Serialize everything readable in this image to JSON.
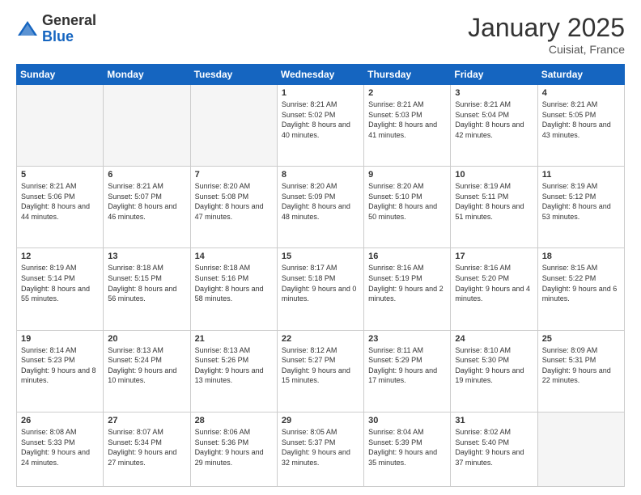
{
  "logo": {
    "general": "General",
    "blue": "Blue"
  },
  "header": {
    "month": "January 2025",
    "location": "Cuisiat, France"
  },
  "days_of_week": [
    "Sunday",
    "Monday",
    "Tuesday",
    "Wednesday",
    "Thursday",
    "Friday",
    "Saturday"
  ],
  "weeks": [
    [
      {
        "day": "",
        "empty": true
      },
      {
        "day": "",
        "empty": true
      },
      {
        "day": "",
        "empty": true
      },
      {
        "day": "1",
        "sunrise": "8:21 AM",
        "sunset": "5:02 PM",
        "daylight": "8 hours and 40 minutes."
      },
      {
        "day": "2",
        "sunrise": "8:21 AM",
        "sunset": "5:03 PM",
        "daylight": "8 hours and 41 minutes."
      },
      {
        "day": "3",
        "sunrise": "8:21 AM",
        "sunset": "5:04 PM",
        "daylight": "8 hours and 42 minutes."
      },
      {
        "day": "4",
        "sunrise": "8:21 AM",
        "sunset": "5:05 PM",
        "daylight": "8 hours and 43 minutes."
      }
    ],
    [
      {
        "day": "5",
        "sunrise": "8:21 AM",
        "sunset": "5:06 PM",
        "daylight": "8 hours and 44 minutes."
      },
      {
        "day": "6",
        "sunrise": "8:21 AM",
        "sunset": "5:07 PM",
        "daylight": "8 hours and 46 minutes."
      },
      {
        "day": "7",
        "sunrise": "8:20 AM",
        "sunset": "5:08 PM",
        "daylight": "8 hours and 47 minutes."
      },
      {
        "day": "8",
        "sunrise": "8:20 AM",
        "sunset": "5:09 PM",
        "daylight": "8 hours and 48 minutes."
      },
      {
        "day": "9",
        "sunrise": "8:20 AM",
        "sunset": "5:10 PM",
        "daylight": "8 hours and 50 minutes."
      },
      {
        "day": "10",
        "sunrise": "8:19 AM",
        "sunset": "5:11 PM",
        "daylight": "8 hours and 51 minutes."
      },
      {
        "day": "11",
        "sunrise": "8:19 AM",
        "sunset": "5:12 PM",
        "daylight": "8 hours and 53 minutes."
      }
    ],
    [
      {
        "day": "12",
        "sunrise": "8:19 AM",
        "sunset": "5:14 PM",
        "daylight": "8 hours and 55 minutes."
      },
      {
        "day": "13",
        "sunrise": "8:18 AM",
        "sunset": "5:15 PM",
        "daylight": "8 hours and 56 minutes."
      },
      {
        "day": "14",
        "sunrise": "8:18 AM",
        "sunset": "5:16 PM",
        "daylight": "8 hours and 58 minutes."
      },
      {
        "day": "15",
        "sunrise": "8:17 AM",
        "sunset": "5:18 PM",
        "daylight": "9 hours and 0 minutes."
      },
      {
        "day": "16",
        "sunrise": "8:16 AM",
        "sunset": "5:19 PM",
        "daylight": "9 hours and 2 minutes."
      },
      {
        "day": "17",
        "sunrise": "8:16 AM",
        "sunset": "5:20 PM",
        "daylight": "9 hours and 4 minutes."
      },
      {
        "day": "18",
        "sunrise": "8:15 AM",
        "sunset": "5:22 PM",
        "daylight": "9 hours and 6 minutes."
      }
    ],
    [
      {
        "day": "19",
        "sunrise": "8:14 AM",
        "sunset": "5:23 PM",
        "daylight": "9 hours and 8 minutes."
      },
      {
        "day": "20",
        "sunrise": "8:13 AM",
        "sunset": "5:24 PM",
        "daylight": "9 hours and 10 minutes."
      },
      {
        "day": "21",
        "sunrise": "8:13 AM",
        "sunset": "5:26 PM",
        "daylight": "9 hours and 13 minutes."
      },
      {
        "day": "22",
        "sunrise": "8:12 AM",
        "sunset": "5:27 PM",
        "daylight": "9 hours and 15 minutes."
      },
      {
        "day": "23",
        "sunrise": "8:11 AM",
        "sunset": "5:29 PM",
        "daylight": "9 hours and 17 minutes."
      },
      {
        "day": "24",
        "sunrise": "8:10 AM",
        "sunset": "5:30 PM",
        "daylight": "9 hours and 19 minutes."
      },
      {
        "day": "25",
        "sunrise": "8:09 AM",
        "sunset": "5:31 PM",
        "daylight": "9 hours and 22 minutes."
      }
    ],
    [
      {
        "day": "26",
        "sunrise": "8:08 AM",
        "sunset": "5:33 PM",
        "daylight": "9 hours and 24 minutes."
      },
      {
        "day": "27",
        "sunrise": "8:07 AM",
        "sunset": "5:34 PM",
        "daylight": "9 hours and 27 minutes."
      },
      {
        "day": "28",
        "sunrise": "8:06 AM",
        "sunset": "5:36 PM",
        "daylight": "9 hours and 29 minutes."
      },
      {
        "day": "29",
        "sunrise": "8:05 AM",
        "sunset": "5:37 PM",
        "daylight": "9 hours and 32 minutes."
      },
      {
        "day": "30",
        "sunrise": "8:04 AM",
        "sunset": "5:39 PM",
        "daylight": "9 hours and 35 minutes."
      },
      {
        "day": "31",
        "sunrise": "8:02 AM",
        "sunset": "5:40 PM",
        "daylight": "9 hours and 37 minutes."
      },
      {
        "day": "",
        "empty": true
      }
    ]
  ]
}
